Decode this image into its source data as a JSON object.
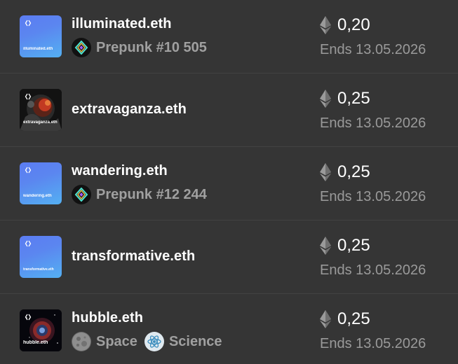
{
  "listings": [
    {
      "name": "illuminated.eth",
      "thumb_label": "illuminated.eth",
      "thumb_style": "gradient",
      "tags": [
        {
          "icon": "prepunk-icon",
          "label": "Prepunk #10 505"
        }
      ],
      "price": "0,20",
      "ends": "Ends 13.05.2026"
    },
    {
      "name": "extravaganza.eth",
      "thumb_label": "extravaganza.eth",
      "thumb_style": "image",
      "tags": [],
      "price": "0,25",
      "ends": "Ends 13.05.2026"
    },
    {
      "name": "wandering.eth",
      "thumb_label": "wandering.eth",
      "thumb_style": "gradient",
      "tags": [
        {
          "icon": "prepunk-icon",
          "label": "Prepunk #12 244"
        }
      ],
      "price": "0,25",
      "ends": "Ends 13.05.2026"
    },
    {
      "name": "transformative.eth",
      "thumb_label": "transformative.eth",
      "thumb_style": "gradient",
      "tags": [],
      "price": "0,25",
      "ends": "Ends 13.05.2026"
    },
    {
      "name": "hubble.eth",
      "thumb_label": "hubble.eth",
      "thumb_style": "image",
      "tags": [
        {
          "icon": "moon-icon",
          "label": "Space"
        },
        {
          "icon": "atom-icon",
          "label": "Science"
        }
      ],
      "price": "0,25",
      "ends": "Ends 13.05.2026"
    }
  ],
  "colors": {
    "background": "#353535",
    "divider": "#424242",
    "text_primary": "#ffffff",
    "text_secondary": "#9a9a9a",
    "thumb_gradient_start": "#5b7cf2",
    "thumb_gradient_end": "#54b0f2"
  }
}
